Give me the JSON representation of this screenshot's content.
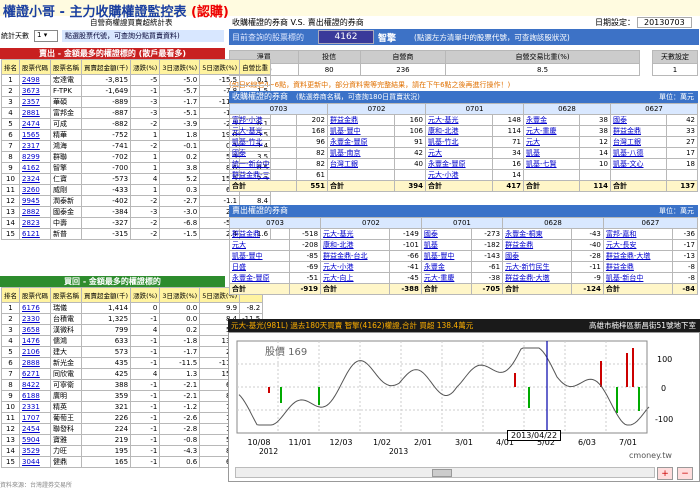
{
  "header": {
    "title": "權證小哥 - 主力收購權證監控表",
    "title_tag": "(認購)",
    "subtitle_left": "自營商權證買賣超統計表",
    "subtitle_right": "收購權證的券商 V.S. 賣出權證的券商",
    "date_label": "日期設定：",
    "date_value": "20130703"
  },
  "controls": {
    "stat_days_label": "統計天數",
    "stat_days_value": "1",
    "note_left": "點選股票代號，可查詢分點買賣資料)",
    "note_right": "(點選左方清單中的股票代號，可查詢該股狀況)"
  },
  "query": {
    "label": "目前查詢的股票標的",
    "code": "4162",
    "name": "智擎"
  },
  "stats": {
    "headers": [
      "淨買",
      "投信",
      "自營商",
      "自營交易比重(%)",
      "天數設定"
    ],
    "values": [
      "-119",
      "80",
      "236",
      "8.5",
      "1"
    ]
  },
  "notice": "(如日K線若4~6點，資料更新中，部分資料需等完整結果，請在下午6點之後再進行操作！)",
  "sell_panel": {
    "title": "賣出 - 金額最多的權證標的 (散戶最看多)",
    "headers": [
      "排名",
      "股票代碼",
      "股票名稱",
      "買賣超金額(千)",
      "漲跌(%)",
      "3日漲跌(%)",
      "5日漲跌(%)",
      "自營比重"
    ],
    "rows": [
      [
        "1",
        "2498",
        "宏達電",
        "-3,815",
        "-5",
        "-5.0",
        "-15.5",
        "0.1"
      ],
      [
        "2",
        "3673",
        "F-TPK",
        "-1,649",
        "-1",
        "-5.7",
        "-7.8",
        "1.5"
      ],
      [
        "3",
        "2357",
        "華碩",
        "-889",
        "-3",
        "-1.7",
        "-11.5",
        "-1.4"
      ],
      [
        "4",
        "2881",
        "富邦金",
        "-887",
        "-3",
        "-5.1",
        "-1.7",
        "1.9"
      ],
      [
        "5",
        "2474",
        "可成",
        "-882",
        "-2",
        "-3.9",
        "-2.3",
        "-6.1"
      ],
      [
        "6",
        "1565",
        "精華",
        "-752",
        "1",
        "1.8",
        "19.8",
        "3.5"
      ],
      [
        "7",
        "2317",
        "鴻海",
        "-741",
        "-2",
        "-0.1",
        "0.3",
        "-1.4"
      ],
      [
        "8",
        "8299",
        "群聯",
        "-702",
        "1",
        "0.2",
        "5.3",
        "3.5"
      ],
      [
        "9",
        "4162",
        "智擎",
        "-700",
        "1",
        "3.8",
        "8.6",
        "8.5"
      ],
      [
        "10",
        "2324",
        "仁寶",
        "-573",
        "4",
        "5.2",
        "15.3",
        "2.3"
      ],
      [
        "11",
        "3260",
        "威剛",
        "-433",
        "1",
        "0.3",
        "6.9",
        "-0.3"
      ],
      [
        "12",
        "9945",
        "潤泰新",
        "-402",
        "-2",
        "-2.7",
        "-1.1",
        "8.4"
      ],
      [
        "13",
        "2882",
        "國泰金",
        "-384",
        "-3",
        "-3.0",
        "2.2",
        "-4.3"
      ],
      [
        "14",
        "2823",
        "中壽",
        "-327",
        "-2",
        "-6.8",
        "-5.3",
        "-4.1"
      ],
      [
        "15",
        "6121",
        "新普",
        "-315",
        "-2",
        "-1.5",
        "2.4",
        "1.6"
      ]
    ]
  },
  "buy_panel": {
    "title": "買回 - 金額最多的權證標的",
    "headers": [
      "排名",
      "股票代碼",
      "股票名稱",
      "買賣超金額(千)",
      "漲跌(%)",
      "3日漲跌(%)",
      "5日漲跌(%)"
    ],
    "rows": [
      [
        "1",
        "6176",
        "瑞儀",
        "1,414",
        "0",
        "0.0",
        "9.9",
        "-8.2"
      ],
      [
        "2",
        "2330",
        "台積電",
        "1,325",
        "-1",
        "0.0",
        "8.4",
        "-11.5"
      ],
      [
        "3",
        "3658",
        "漢微科",
        "799",
        "4",
        "0.2",
        "5.0",
        "-6.5"
      ],
      [
        "4",
        "1476",
        "儒鴻",
        "633",
        "-1",
        "-1.8",
        "13.4",
        "-11.4"
      ],
      [
        "5",
        "2106",
        "建大",
        "573",
        "-1",
        "-1.7",
        "2.7",
        "-8.0"
      ],
      [
        "6",
        "2888",
        "新光金",
        "435",
        "-1",
        "-11.5",
        "-11.9",
        "-6.3"
      ],
      [
        "7",
        "6271",
        "同欣電",
        "425",
        "4",
        "1.3",
        "15.1",
        "-8.5"
      ],
      [
        "8",
        "8422",
        "可寧衛",
        "388",
        "-1",
        "-2.1",
        "6.3",
        "-7.0"
      ],
      [
        "9",
        "6188",
        "廣明",
        "359",
        "-1",
        "-2.1",
        "8.3",
        "-8.0"
      ],
      [
        "10",
        "2331",
        "精英",
        "321",
        "-1",
        "-1.2",
        "7.6",
        "-0.0"
      ],
      [
        "11",
        "1707",
        "葡萄王",
        "226",
        "-1",
        "-2.6",
        "1.9",
        "-9.4"
      ],
      [
        "12",
        "2454",
        "聯發科",
        "224",
        "-1",
        "-2.8",
        "1.9",
        "-5.1"
      ],
      [
        "13",
        "5904",
        "寶雅",
        "219",
        "-1",
        "-0.8",
        "5.8",
        "-8.0"
      ],
      [
        "14",
        "3529",
        "力旺",
        "195",
        "-1",
        "-4.3",
        "8.1",
        "-9.2"
      ],
      [
        "15",
        "3044",
        "健鼎",
        "165",
        "-1",
        "0.6",
        "6.9",
        "-4.5"
      ]
    ]
  },
  "buy_brokers": {
    "title": "收購權證的券商",
    "subtitle": "(點選券商名稱，可查詢180日買賣狀況)",
    "unit": "單位：萬元",
    "dates": [
      "0703",
      "0702",
      "0701",
      "0628",
      "0627"
    ],
    "cols": [
      [
        [
          "富邦-小港",
          "202"
        ],
        [
          "元大-基光",
          "168"
        ],
        [
          "凱基-竹北",
          "96"
        ],
        [
          "國泰",
          "82"
        ],
        [
          "統一-新台中",
          "82"
        ],
        [
          "群益金鼎-三",
          "61"
        ],
        [
          "合計",
          "551"
        ]
      ],
      [
        [
          "群益金鼎",
          "160"
        ],
        [
          "凱基-豐中",
          "106"
        ],
        [
          "永豐金-豐原",
          "91"
        ],
        [
          "凱基-南京",
          "42"
        ],
        [
          "台灣工銀",
          "40"
        ],
        [
          "",
          ""
        ],
        [
          "合計",
          "394"
        ]
      ],
      [
        [
          "元大-基光",
          "148"
        ],
        [
          "康和-北港",
          "114"
        ],
        [
          "凱基-竹北",
          "71"
        ],
        [
          "元大",
          "34"
        ],
        [
          "永豐金-豐原",
          "16"
        ],
        [
          "元大-小港",
          "14"
        ],
        [
          "合計",
          "417"
        ]
      ],
      [
        [
          "永豐金",
          "38"
        ],
        [
          "元大-重慶",
          "38"
        ],
        [
          "元大",
          "12"
        ],
        [
          "凱基",
          "14"
        ],
        [
          "凱基-七賢",
          "10"
        ],
        [
          "",
          ""
        ],
        [
          "合計",
          "114"
        ]
      ],
      [
        [
          "國泰",
          "42"
        ],
        [
          "群益金鼎",
          "33"
        ],
        [
          "台灣工銀",
          "27"
        ],
        [
          "凱基-八德",
          "17"
        ],
        [
          "凱基-文心",
          "18"
        ],
        [
          "",
          ""
        ],
        [
          "合計",
          "137"
        ]
      ]
    ]
  },
  "sell_brokers": {
    "title": "賣出權證的券商",
    "unit": "單位：萬元",
    "dates": [
      "0703",
      "0702",
      "0701",
      "0628",
      "0627"
    ],
    "cols": [
      [
        [
          "群益金鼎",
          "-518"
        ],
        [
          "元大",
          "-208"
        ],
        [
          "凱基-豐中",
          "-85"
        ],
        [
          "日盛",
          "-69"
        ],
        [
          "永豐金-豐原",
          "-51"
        ],
        [
          "合計",
          "-919"
        ]
      ],
      [
        [
          "元大-基光",
          "-149"
        ],
        [
          "康和-北港",
          "-101"
        ],
        [
          "群益金鼎-台北",
          "-66"
        ],
        [
          "元大-小港",
          "-41"
        ],
        [
          "元大-向上",
          "-45"
        ],
        [
          "合計",
          "-388"
        ]
      ],
      [
        [
          "國泰",
          "-273"
        ],
        [
          "凱基",
          "-182"
        ],
        [
          "凱基-豐中",
          "-143"
        ],
        [
          "永豐金",
          "-61"
        ],
        [
          "元大-重慶",
          "-38"
        ],
        [
          "合計",
          "-705"
        ]
      ],
      [
        [
          "永豐金-桐東",
          "-43"
        ],
        [
          "群益金鼎",
          "-40"
        ],
        [
          "國泰",
          "-28"
        ],
        [
          "元大-新竹民生",
          "-11"
        ],
        [
          "群益金鼎-大墩",
          "-9"
        ],
        [
          "合計",
          "-124"
        ]
      ],
      [
        [
          "富邦-嘉和",
          "-36"
        ],
        [
          "元大-長安",
          "-17"
        ],
        [
          "群益金鼎-大墩",
          "-13"
        ],
        [
          "群益金鼎",
          "-8"
        ],
        [
          "凱基-新台中",
          "-8"
        ],
        [
          "合計",
          "-84"
        ]
      ]
    ]
  },
  "chart": {
    "bar_left": "元大-基光(981L) 過去180天買賣 智擎(4162)權證,合計  買超 138.4萬元",
    "bar_right": "高雄市楠梓區新昌街51號地下室",
    "overlay": "股價 169",
    "cursor_date": "2013/04/22",
    "x_ticks": [
      "10/08",
      "11/01",
      "12/03",
      "1/02",
      "2/01",
      "3/01",
      "4/01",
      "5/02",
      "6/03",
      "7/01"
    ],
    "years": [
      "2012",
      "2013"
    ],
    "y_right": [
      "100",
      "0",
      "-100"
    ],
    "watermark": "cmoney.tw"
  },
  "footer": "資料來源：台灣證券交易所"
}
